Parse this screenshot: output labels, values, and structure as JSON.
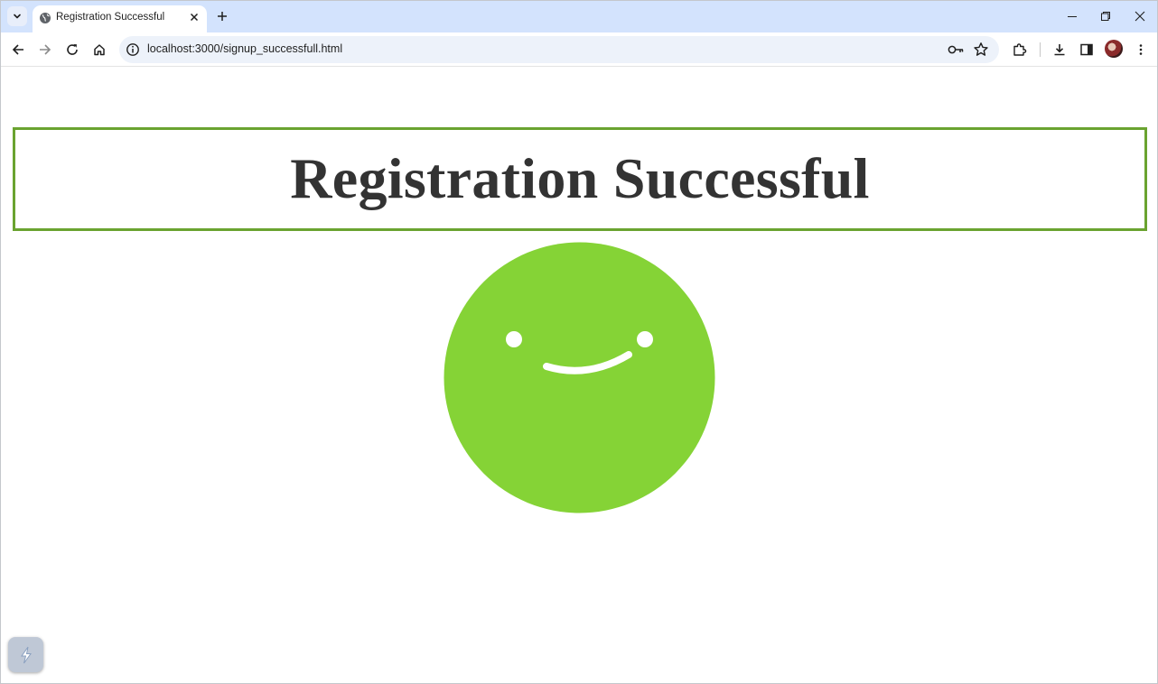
{
  "browser": {
    "tab": {
      "title": "Registration Successful"
    },
    "address": {
      "url": "localhost:3000/signup_successfull.html"
    },
    "icons": {
      "tab_search": "chevron-down-icon",
      "favicon": "globe-icon",
      "tab_close": "close-icon",
      "new_tab": "plus-icon",
      "minimize": "minimize-icon",
      "restore": "restore-icon",
      "close_window": "close-icon",
      "back": "arrow-left-icon",
      "forward": "arrow-right-icon",
      "reload": "reload-icon",
      "home": "home-icon",
      "site_info": "info-icon",
      "password": "key-icon",
      "bookmark": "star-icon",
      "extensions": "puzzle-icon",
      "downloads": "download-icon",
      "side_panel": "side-panel-icon",
      "profile": "avatar",
      "menu": "kebab-menu-icon"
    }
  },
  "page": {
    "title": "Registration Successful",
    "accent_color": "#6aa330",
    "smiley_color": "#85d336",
    "title_color": "#333333"
  },
  "overlay": {
    "icon": "extension-lightning-icon"
  }
}
